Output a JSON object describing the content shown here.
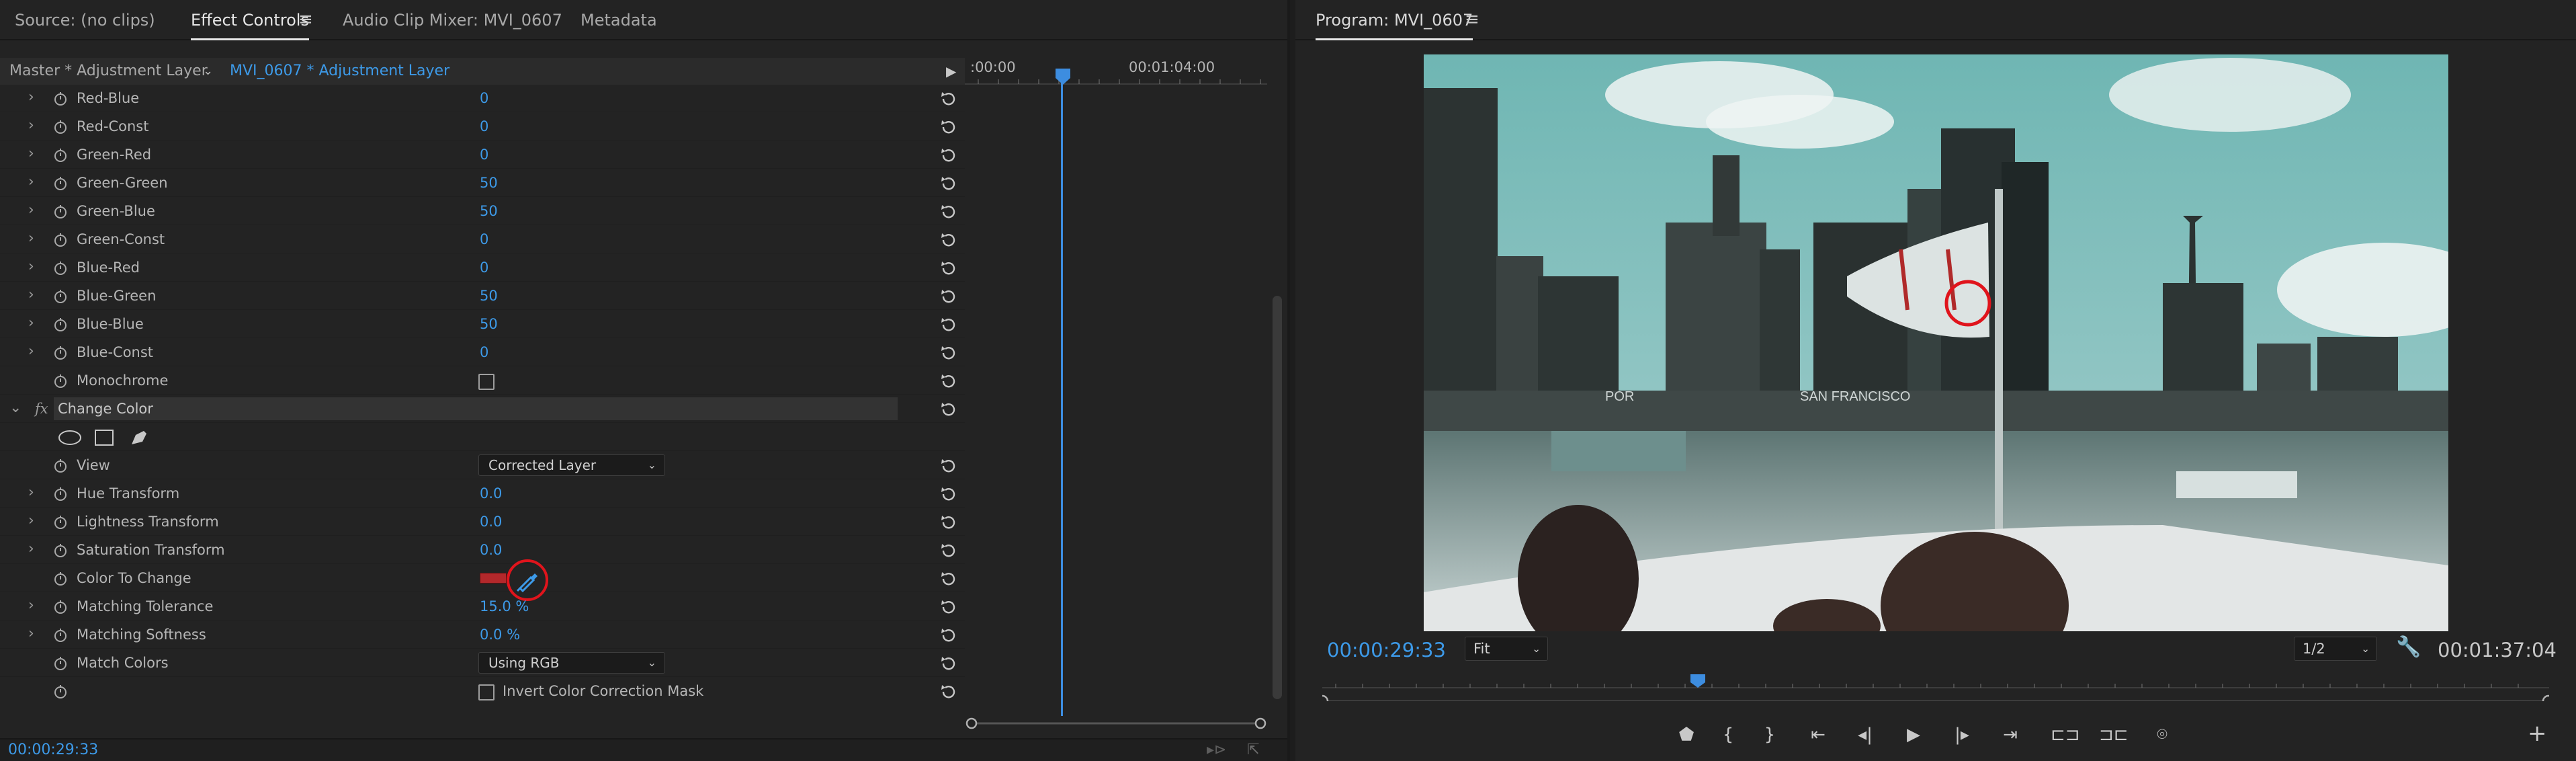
{
  "source_tab": "Source: (no clips)",
  "effect_controls_tab": "Effect Controls",
  "audio_mixer_tab": "Audio Clip Mixer: MVI_0607",
  "metadata_tab": "Metadata",
  "master_label": "Master * Adjustment Layer",
  "clip_label": "MVI_0607 * Adjustment Layer",
  "ruler": {
    "start": ":00:00",
    "mid": "00:01:04:00"
  },
  "channel_rows": [
    {
      "label": "Red-Blue",
      "value": "0"
    },
    {
      "label": "Red-Const",
      "value": "0"
    },
    {
      "label": "Green-Red",
      "value": "0"
    },
    {
      "label": "Green-Green",
      "value": "50"
    },
    {
      "label": "Green-Blue",
      "value": "50"
    },
    {
      "label": "Green-Const",
      "value": "0"
    },
    {
      "label": "Blue-Red",
      "value": "0"
    },
    {
      "label": "Blue-Green",
      "value": "50"
    },
    {
      "label": "Blue-Blue",
      "value": "50"
    },
    {
      "label": "Blue-Const",
      "value": "0"
    }
  ],
  "monochrome_label": "Monochrome",
  "fx_symbol": "fx",
  "change_color_label": "Change Color",
  "view_label": "View",
  "view_value": "Corrected Layer",
  "hue_transform": {
    "label": "Hue Transform",
    "value": "0.0"
  },
  "lightness_transform": {
    "label": "Lightness Transform",
    "value": "0.0"
  },
  "saturation_transform": {
    "label": "Saturation Transform",
    "value": "0.0"
  },
  "color_to_change_label": "Color To Change",
  "color_swatch": "#b3282b",
  "matching_tolerance": {
    "label": "Matching Tolerance",
    "value": "15.0 %"
  },
  "matching_softness": {
    "label": "Matching Softness",
    "value": "0.0 %"
  },
  "match_colors_label": "Match Colors",
  "match_colors_value": "Using RGB",
  "invert_mask_label": "Invert Color Correction Mask",
  "bottom_timecode": "00:00:29:33",
  "program_tab": "Program: MVI_0607",
  "program_timecode": "00:00:29:33",
  "fit_value": "Fit",
  "resolution_value": "1/2",
  "duration": "00:01:37:04",
  "video_signs": {
    "left": "POR",
    "right": "SAN FRANCISCO"
  },
  "colors": {
    "accent_blue": "#3d9ae8",
    "annotation_red": "#e0141c",
    "panel": "#232323"
  }
}
